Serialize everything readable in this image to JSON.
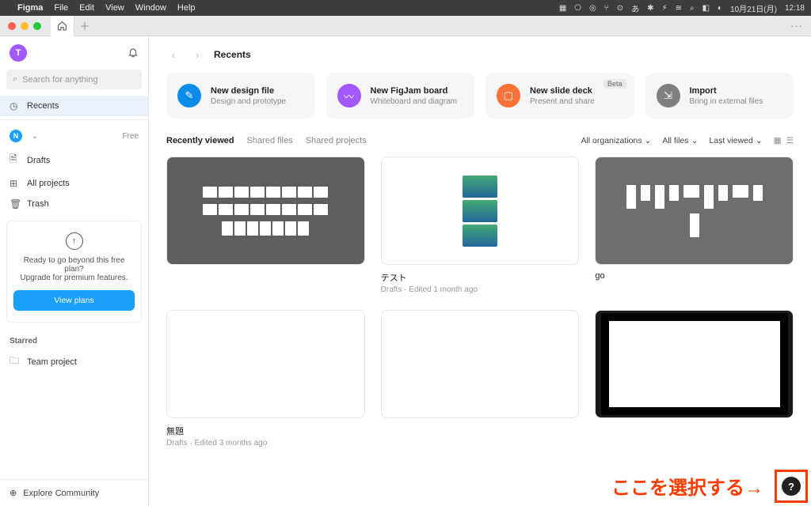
{
  "menubar": {
    "app": "Figma",
    "items": [
      "File",
      "Edit",
      "View",
      "Window",
      "Help"
    ],
    "right_icons": [
      "▦",
      "⎔",
      "◎",
      "⑂",
      "⊙",
      "あ",
      "✱",
      "⚡︎",
      "≋",
      "⌕",
      "◧",
      "◐"
    ],
    "date": "10月21日(月)",
    "time": "12:18"
  },
  "sidebar": {
    "avatar_letter": "T",
    "search_placeholder": "Search for anything",
    "recents": "Recents",
    "workspace_letter": "N",
    "plan_label": "Free",
    "nav": {
      "drafts": "Drafts",
      "all_projects": "All projects",
      "trash": "Trash"
    },
    "upgrade": {
      "line1": "Ready to go beyond this free plan?",
      "line2": "Upgrade for premium features.",
      "button": "View plans"
    },
    "starred_label": "Starred",
    "team_project": "Team project",
    "explore": "Explore Community"
  },
  "header": {
    "title": "Recents"
  },
  "actions": [
    {
      "title": "New design file",
      "sub": "Design and prototype",
      "color": "ai-blue"
    },
    {
      "title": "New FigJam board",
      "sub": "Whiteboard and diagram",
      "color": "ai-purple"
    },
    {
      "title": "New slide deck",
      "sub": "Present and share",
      "color": "ai-orange",
      "badge": "Beta"
    },
    {
      "title": "Import",
      "sub": "Bring in external files",
      "color": "ai-gray"
    }
  ],
  "tabs": {
    "recently": "Recently viewed",
    "shared_files": "Shared files",
    "shared_projects": "Shared projects"
  },
  "filters": {
    "org": "All organizations",
    "files": "All files",
    "sort": "Last viewed"
  },
  "files": [
    {
      "title": "",
      "sub": ""
    },
    {
      "title": "テスト",
      "sub": "Drafts  ·  Edited 1 month ago"
    },
    {
      "title": "go",
      "sub": ""
    },
    {
      "title": "無題",
      "sub": "Drafts  ·  Edited 3 months ago"
    },
    {
      "title": "",
      "sub": ""
    },
    {
      "title": "",
      "sub": ""
    }
  ],
  "annotation": "ここを選択する→",
  "help": "?"
}
